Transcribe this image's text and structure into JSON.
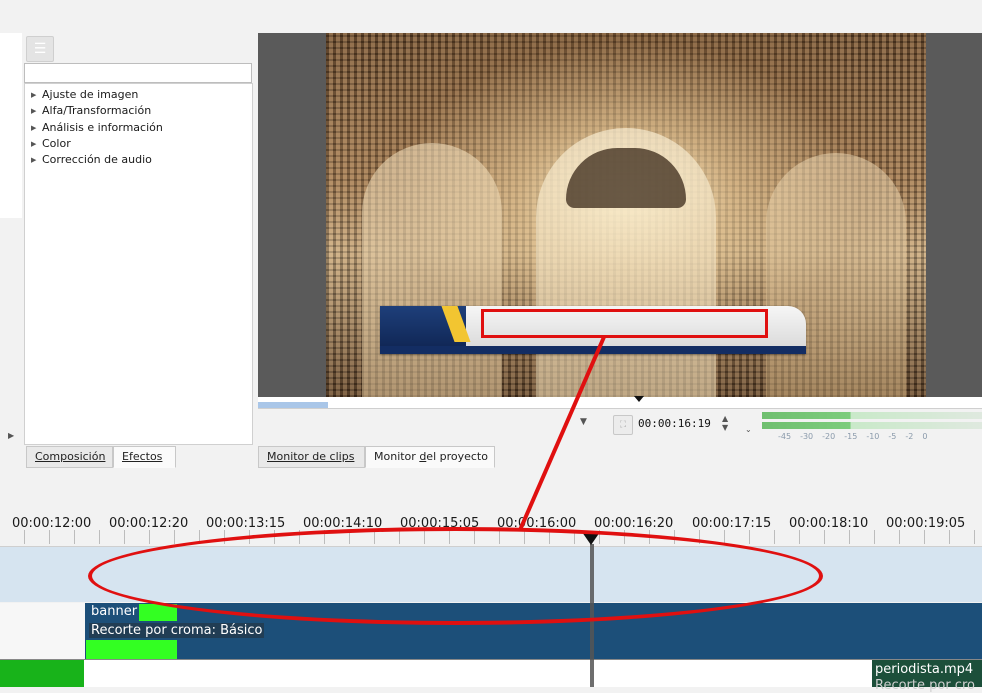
{
  "effects_panel": {
    "categories": [
      {
        "label": "Ajuste de imagen"
      },
      {
        "label": "Alfa/Transformación"
      },
      {
        "label": "Análisis e información"
      },
      {
        "label": "Color"
      },
      {
        "label": "Corrección de audio"
      }
    ],
    "tabs": {
      "composition": "Composición",
      "effects": "Efectos",
      "active": "effects"
    }
  },
  "monitor": {
    "timecode": "00:00:16:19",
    "tabs": {
      "clip_monitor": "Monitor de clips",
      "project_monitor_prefix": "Monitor ",
      "project_monitor_underlined": "d",
      "project_monitor_suffix": "el proyecto",
      "active": "project_monitor"
    },
    "audio_meter_labels": [
      "-45",
      "-30",
      "-20",
      "-15",
      "-10",
      "-5",
      "-2",
      "0"
    ]
  },
  "timeline": {
    "ruler_labels": [
      "00:00:12:00",
      "00:00:12:20",
      "00:00:13:15",
      "00:00:14:10",
      "00:00:15:05",
      "00:00:16:00",
      "00:00:16:20",
      "00:00:17:15",
      "00:00:18:10",
      "00:00:19:05"
    ],
    "clip_banner": {
      "name": "banner",
      "effect": "Recorte por croma: Básico"
    },
    "clip_periodista": {
      "name": "periodista.mp4",
      "effect": "Recorte por cro"
    }
  },
  "colors": {
    "annotation_red": "#e01010",
    "clip_blue": "#1c4f79",
    "clip_green": "#33ff22",
    "track_highlight": "#d6e4f0"
  }
}
